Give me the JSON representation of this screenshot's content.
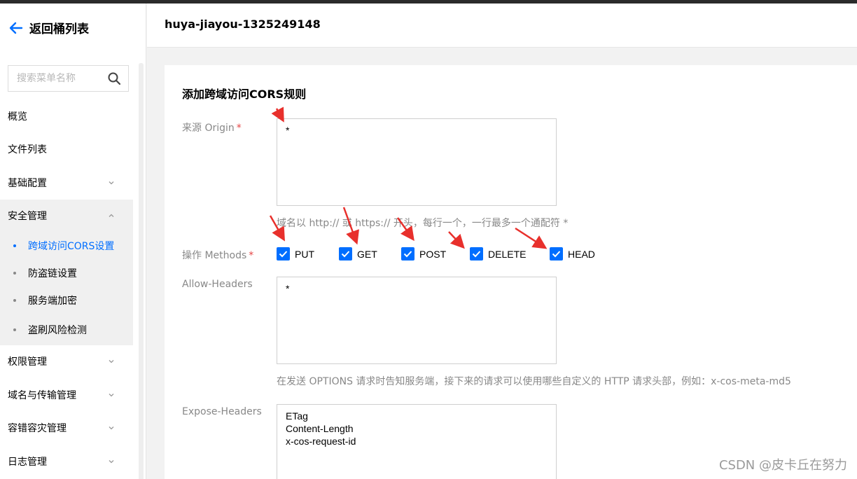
{
  "sidebar": {
    "back_label": "返回桶列表",
    "search_placeholder": "搜索菜单名称",
    "items": [
      {
        "label": "概览"
      },
      {
        "label": "文件列表"
      },
      {
        "label": "基础配置"
      },
      {
        "label": "安全管理"
      },
      {
        "label": "权限管理"
      },
      {
        "label": "域名与传输管理"
      },
      {
        "label": "容错容灾管理"
      },
      {
        "label": "日志管理"
      }
    ],
    "security_sub_items": [
      {
        "label": "跨域访问CORS设置",
        "active": true
      },
      {
        "label": "防盗链设置"
      },
      {
        "label": "服务端加密"
      },
      {
        "label": "盗刷风险检测"
      }
    ]
  },
  "header": {
    "title": "huya-jiayou-1325249148"
  },
  "form": {
    "title": "添加跨域访问CORS规则",
    "origin": {
      "label": "来源 Origin",
      "value": "*",
      "hint": "域名以 http:// 或 https:// 开头，每行一个，一行最多一个通配符 *"
    },
    "methods": {
      "label": "操作 Methods",
      "options": [
        {
          "label": "PUT",
          "checked": true
        },
        {
          "label": "GET",
          "checked": true
        },
        {
          "label": "POST",
          "checked": true
        },
        {
          "label": "DELETE",
          "checked": true
        },
        {
          "label": "HEAD",
          "checked": true
        }
      ]
    },
    "allow_headers": {
      "label": "Allow-Headers",
      "value": "*",
      "hint": "在发送 OPTIONS 请求时告知服务端，接下来的请求可以使用哪些自定义的 HTTP 请求头部，例如：x-cos-meta-md5"
    },
    "expose_headers": {
      "label": "Expose-Headers",
      "value": "ETag\nContent-Length\nx-cos-request-id"
    },
    "required_mark": "*"
  },
  "watermark": "CSDN @皮卡丘在努力",
  "colors": {
    "accent": "#006eff",
    "annotation_arrow": "#e8302c",
    "required": "#e54545"
  }
}
